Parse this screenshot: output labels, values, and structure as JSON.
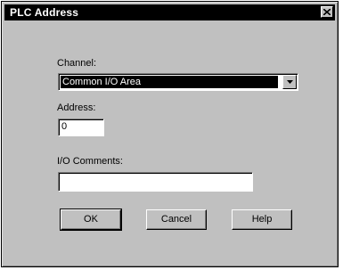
{
  "window": {
    "title": "PLC Address",
    "close_icon": "close-icon"
  },
  "channel": {
    "label": "Channel:",
    "selected": "Common I/O Area",
    "dropdown_icon": "chevron-down-icon"
  },
  "address": {
    "label": "Address:",
    "value": "0"
  },
  "io_comments": {
    "label": "I/O Comments:",
    "value": ""
  },
  "buttons": {
    "ok": "OK",
    "cancel": "Cancel",
    "help": "Help"
  }
}
